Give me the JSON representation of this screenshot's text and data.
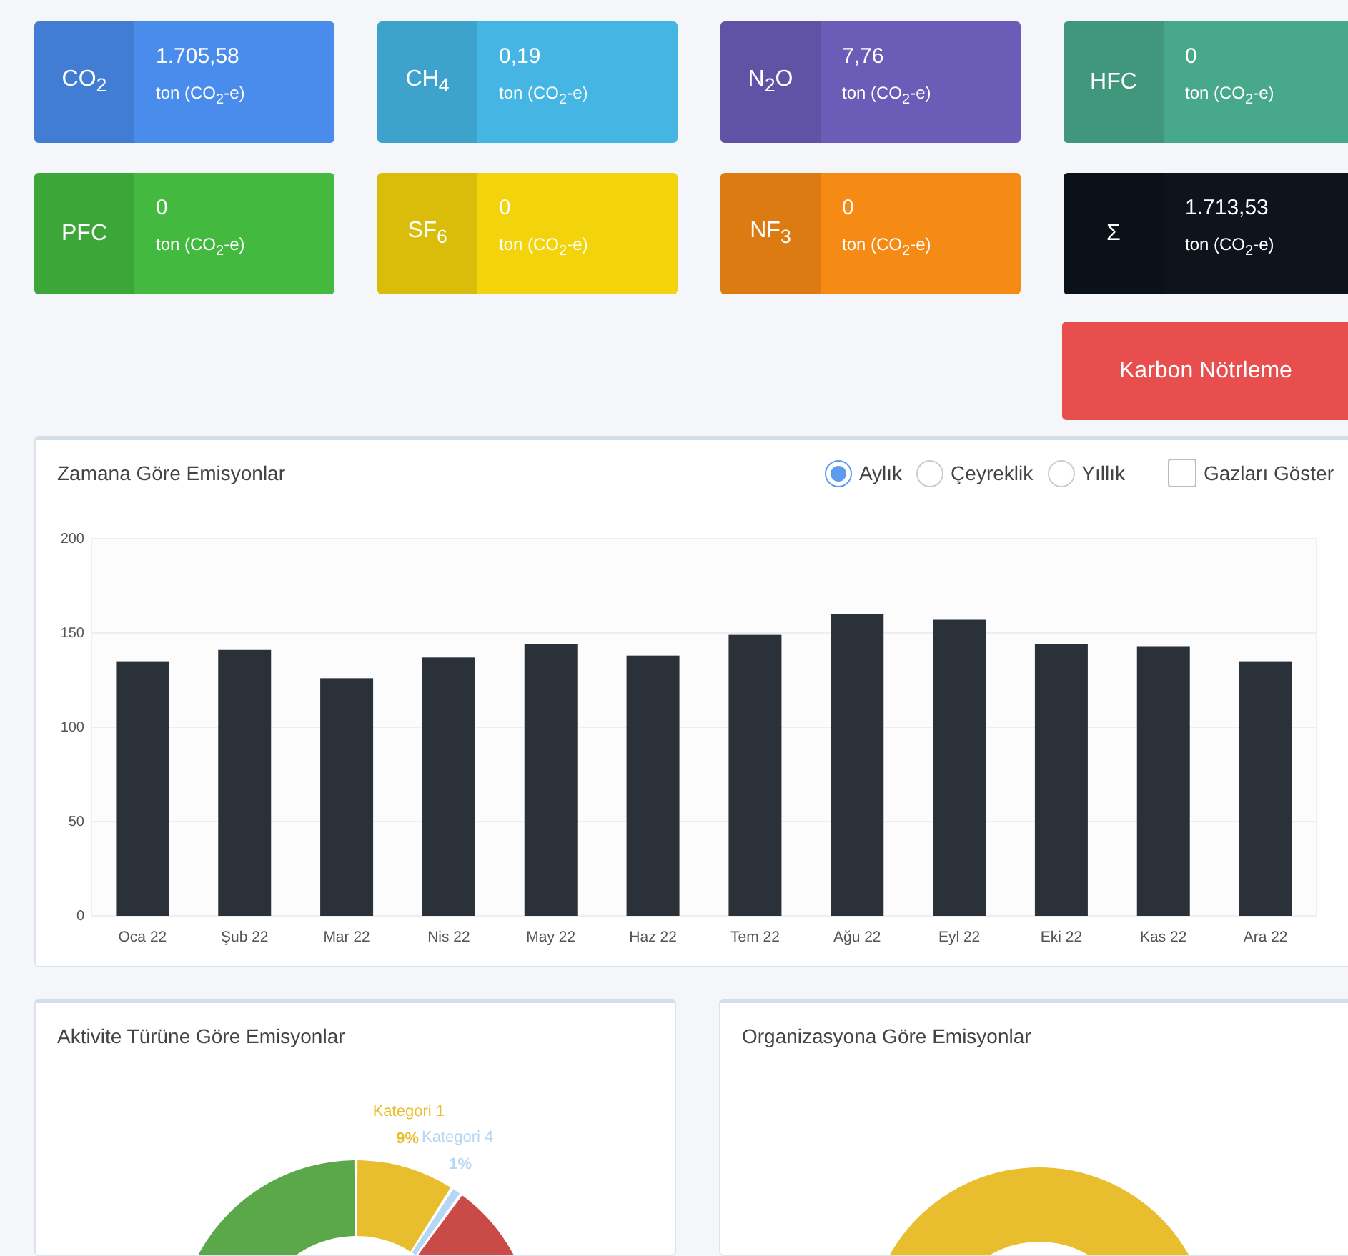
{
  "gas_cards": [
    {
      "symbol": "CO$_{2}$",
      "value": "1.705,58",
      "unit": "ton (CO$_{2}$-e)",
      "color": "#4a8cec"
    },
    {
      "symbol": "CH$_{4}$",
      "value": "0,19",
      "unit": "ton (CO$_{2}$-e)",
      "color": "#45b5e4"
    },
    {
      "symbol": "N$_{2}$O",
      "value": "7,76",
      "unit": "ton (CO$_{2}$-e)",
      "color": "#6b5cb8"
    },
    {
      "symbol": "HFC",
      "value": "0",
      "unit": "ton (CO$_{2}$-e)",
      "color": "#48a98a"
    },
    {
      "symbol": "PFC",
      "value": "0",
      "unit": "ton (CO$_{2}$-e)",
      "color": "#43ba3f"
    },
    {
      "symbol": "SF$_{6}$",
      "value": "0",
      "unit": "ton (CO$_{2}$-e)",
      "color": "#f2d30c"
    },
    {
      "symbol": "NF$_{3}$",
      "value": "0",
      "unit": "ton (CO$_{2}$-e)",
      "color": "#f58a14"
    },
    {
      "symbol": "Σ",
      "value": "1.713,53",
      "unit": "ton (CO$_{2}$-e)",
      "color": "#0d141b"
    }
  ],
  "action_button": "Karbon Nötrleme",
  "time_panel": {
    "title": "Zamana Göre Emisyonlar",
    "period_options": [
      {
        "label": "Aylık",
        "selected": true
      },
      {
        "label": "Çeyreklik",
        "selected": false
      },
      {
        "label": "Yıllık",
        "selected": false
      }
    ],
    "show_gases": {
      "label": "Gazları Göster",
      "checked": false
    },
    "chart_data": {
      "type": "bar",
      "categories": [
        "Oca 22",
        "Şub 22",
        "Mar 22",
        "Nis 22",
        "May 22",
        "Haz 22",
        "Tem 22",
        "Ağu 22",
        "Eyl 22",
        "Eki 22",
        "Kas 22",
        "Ara 22"
      ],
      "series": [
        {
          "color": "#2b3138",
          "values": [
            135,
            141,
            126,
            137,
            144,
            138,
            149,
            160,
            157,
            144,
            143,
            135
          ]
        }
      ],
      "ylim": [
        0,
        200
      ],
      "yticks": [
        0,
        50,
        100,
        150,
        200
      ],
      "grid": true
    }
  },
  "activity_panel": {
    "title": "Aktivite Türüne Göre Emisyonlar",
    "labels": [
      {
        "name": "Kategori 1",
        "percent": "9%",
        "color": "#e8be2e"
      },
      {
        "name": "Kategori 4",
        "percent": "1%",
        "color": "#b5d6f5"
      }
    ]
  },
  "organization_panel": {
    "title": "Organizasyona Göre Emisyonlar"
  }
}
